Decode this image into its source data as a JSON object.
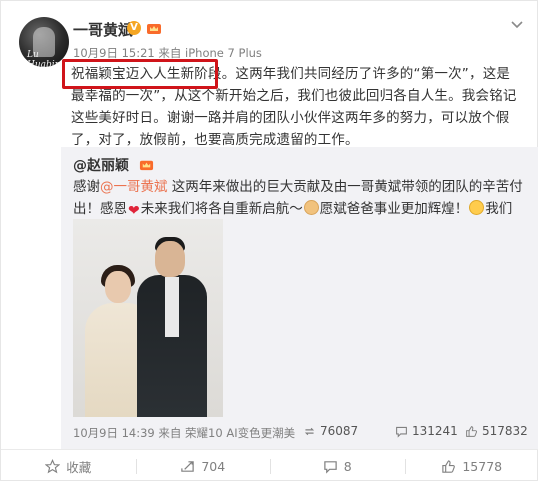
{
  "post": {
    "username": "一哥黄斌",
    "verified_badge": "V",
    "meta": "10月9日 15:21 来自 iPhone 7 Plus",
    "avatar_caption": "Lu Huabin",
    "text_highlight": "祝福颖宝迈入人生新阶段。",
    "text_rest": "这两年我们共同经历了许多的“第一次”，这是最幸福的一次”，从这个新开始之后，我们也彼此回归各自人生。我会铭记这些美好时日。谢谢一路并肩的团队小伙伴这两年多的努力，可以放个假了，对了，放假前，也要高质完成遗留的工作。"
  },
  "repost": {
    "username": "@赵丽颖",
    "text_1": "感谢",
    "mention": "@一哥黄斌",
    "text_2": " 这两年来做出的巨大贡献及由一哥黄斌带领的团队的辛苦付出！感恩",
    "text_3": "未来我们将各自重新启航～",
    "text_4": "愿斌爸爸事业更加辉煌！",
    "text_5": "我们各自珍重",
    "meta": "10月9日 14:39 来自 荣耀10 AI变色更潮美",
    "stats": {
      "reposts": "76087",
      "comments": "131241",
      "likes": "517832"
    }
  },
  "actions": {
    "favorite": "收藏",
    "repost": "704",
    "comment": "8",
    "like": "15778"
  },
  "colors": {
    "highlight_box": "#d0141a",
    "mention": "#eb7350",
    "repost_bg": "#f2f2f5",
    "badge": "#f5a623"
  },
  "icons": {
    "chevron": "chevron-down-icon",
    "favorite": "star-icon",
    "repost": "repost-icon",
    "comment": "comment-icon",
    "like": "thumbs-up-icon"
  }
}
